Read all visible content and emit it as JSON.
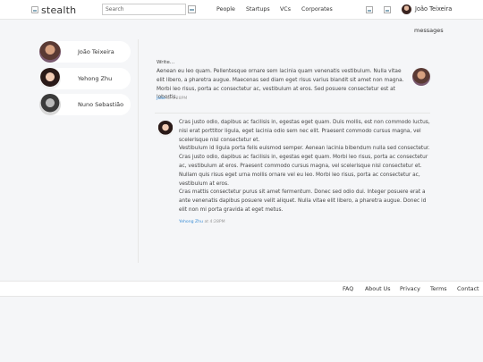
{
  "header": {
    "logo_text": "stealth",
    "search_placeholder": "Search",
    "nav": [
      "People",
      "Startups",
      "VCs",
      "Corporates"
    ],
    "user_name": "João Teixeira"
  },
  "page_label": "messages",
  "contacts": [
    {
      "name": "João Teixeira"
    },
    {
      "name": "Yehong Zhu"
    },
    {
      "name": "Nuno Sebastião"
    }
  ],
  "composer": {
    "label": "Write...",
    "text": "Aenean eu leo quam. Pellentesque ornare sem lacinia quam venenatis vestibulum. Nulla vitae elit libero, a pharetra augue. Maecenas sed diam eget risus varius blandit sit amet non magna. Morbi leo risus, porta ac consectetur ac, vestibulum at eros. Sed posuere consectetur est at lobortis.",
    "author": "João",
    "time": "at 4:28PM"
  },
  "reply": {
    "paragraphs": [
      "Cras justo odio, dapibus ac facilisis in, egestas eget quam. Duis mollis, est non commodo luctus, nisi erat porttitor ligula, eget lacinia odio sem nec elit. Praesent commodo cursus magna, vel scelerisque nisl consectetur et.",
      "Vestibulum id ligula porta felis euismod semper. Aenean lacinia bibendum nulla sed consectetur. Cras justo odio, dapibus ac facilisis in, egestas eget quam. Morbi leo risus, porta ac consectetur ac, vestibulum at eros. Praesent commodo cursus magna, vel scelerisque nisl consectetur et. Nullam quis risus eget urna mollis ornare vel eu leo. Morbi leo risus, porta ac consectetur ac, vestibulum at eros.",
      "Cras mattis consectetur purus sit amet fermentum. Donec sed odio dui. Integer posuere erat a ante venenatis dapibus posuere velit aliquet. Nulla vitae elit libero, a pharetra augue. Donec id elit non mi porta gravida at eget metus."
    ],
    "author": "Yehong Zhu",
    "time": "at 4:28PM"
  },
  "footer": {
    "links": [
      "FAQ",
      "About Us",
      "Privacy",
      "Terms",
      "Contact"
    ]
  },
  "colors": {
    "accent": "#3d8fd6",
    "background": "#f5f6f8",
    "surface": "#ffffff"
  }
}
